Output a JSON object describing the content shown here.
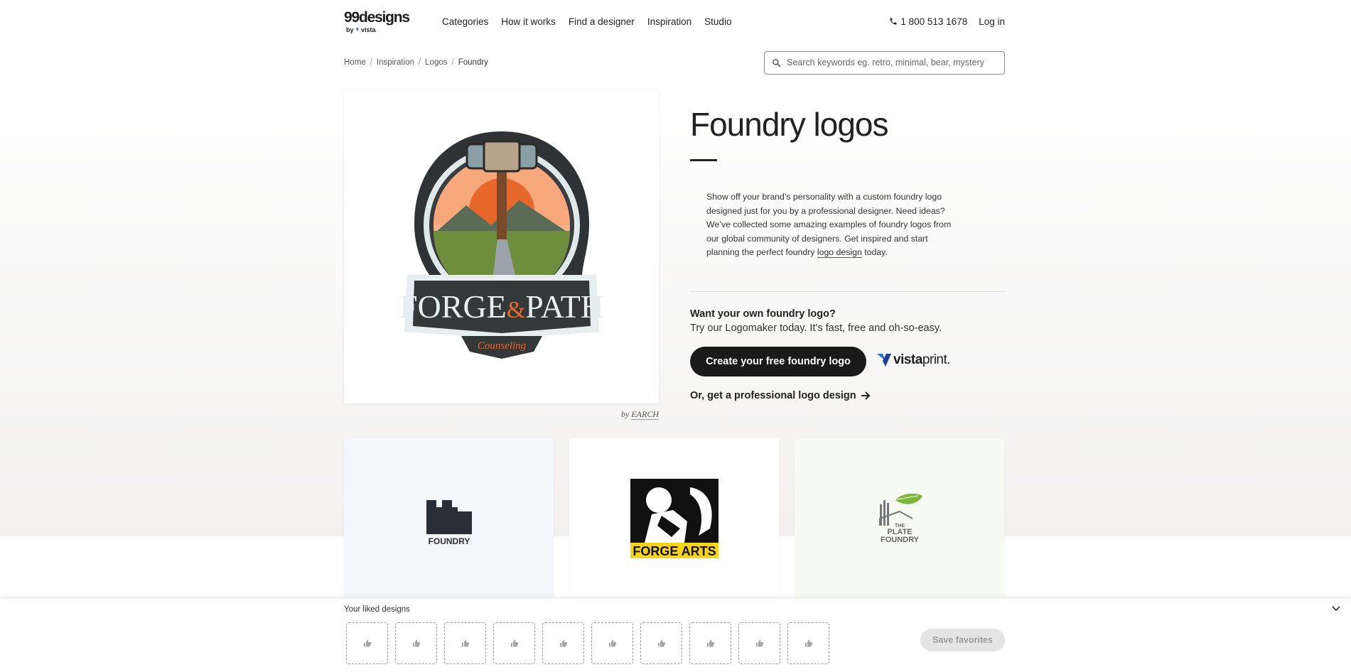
{
  "header": {
    "logo_word": "99designs",
    "logo_by": "by",
    "logo_vista": "vista",
    "nav": [
      "Categories",
      "How it works",
      "Find a designer",
      "Inspiration",
      "Studio"
    ],
    "phone": "1 800 513 1678",
    "login": "Log in"
  },
  "breadcrumb": [
    "Home",
    "Inspiration",
    "Logos",
    "Foundry"
  ],
  "search": {
    "placeholder": "Search keywords eg. retro, minimal, bear, mystery"
  },
  "hero": {
    "logo_main_left": "FORGE",
    "logo_amp": "&",
    "logo_main_right": "PATH",
    "logo_sub": "Counseling",
    "byline_prefix": "by",
    "byline_author": "EARCH"
  },
  "main": {
    "title": "Foundry logos",
    "desc_before": "Show off your brand’s personality with a custom foundry logo designed just for you by a professional designer. Need ideas? We’ve collected some amazing examples of foundry logos from our global community of designers. Get inspired and start planning the perfect foundry ",
    "desc_link": "logo design",
    "desc_after": " today.",
    "cta_heading": "Want your own foundry logo?",
    "cta_sub": "Try our Logomaker today. It’s fast, free and oh-so-easy.",
    "cta_button": "Create your free foundry logo",
    "vistaprint_a": "vista",
    "vistaprint_b": "print.",
    "pro_link": "Or, get a professional logo design"
  },
  "tiles": [
    {
      "text": "FOUNDRY"
    },
    {
      "text": "FORGE ARTS"
    },
    {
      "line1": "THE",
      "line2": "PLATE",
      "line3": "FOUNDRY"
    }
  ],
  "liked": {
    "title": "Your liked designs",
    "slot_count": 10,
    "save_button": "Save favorites"
  },
  "colors": {
    "accent_dark": "#1a1a1a",
    "vista_blue": "#1d6fd6",
    "leaf_green": "#7cb83a",
    "forge_yellow": "#f7d417",
    "hero_orange": "#e8672a"
  }
}
